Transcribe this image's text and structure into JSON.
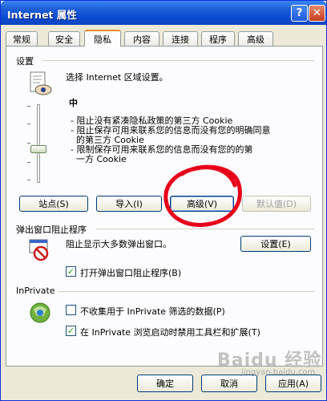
{
  "window": {
    "title": "Internet 属性",
    "help": "?",
    "close": "✕"
  },
  "tabs": [
    "常规",
    "安全",
    "隐私",
    "内容",
    "连接",
    "程序",
    "高级"
  ],
  "settings": {
    "group_label": "设置",
    "description": "选择 Internet 区域设置。",
    "level": "中",
    "details": [
      "- 阻止没有紧凑隐私政策的第三方 Cookie",
      "- 阻止保存可用来联系您的信息而没有您的明确同意",
      "  的第三方 Cookie",
      "- 限制保存可用来联系您的信息而没有您的的第",
      "  一方 Cookie"
    ],
    "buttons": {
      "sites": "站点(S)",
      "import": "导入(I)",
      "advanced": "高级(V)",
      "default": "默认值(D)"
    }
  },
  "popup": {
    "group_label": "弹出窗口阻止程序",
    "description": "阻止显示大多数弹出窗口。",
    "settings_button": "设置(E)",
    "enable_label": "打开弹出窗口阻止程序(B)",
    "enable_checked": true
  },
  "inprivate": {
    "group_label": "InPrivate",
    "option1": "不收集用于 InPrivate 筛选的数据(P)",
    "option1_checked": false,
    "option2": "在 InPrivate 浏览启动时禁用工具栏和扩展(T)",
    "option2_checked": true
  },
  "footer": {
    "ok": "确定",
    "cancel": "取消",
    "apply": "应用(A)"
  },
  "watermark": {
    "brand": "Baidu 经验",
    "url": "jingyan.baidu.com"
  },
  "colors": {
    "title_bar": "#0a4bd0",
    "active_tab_border": "#e68b2c",
    "annotation_circle": "#e8001a"
  }
}
